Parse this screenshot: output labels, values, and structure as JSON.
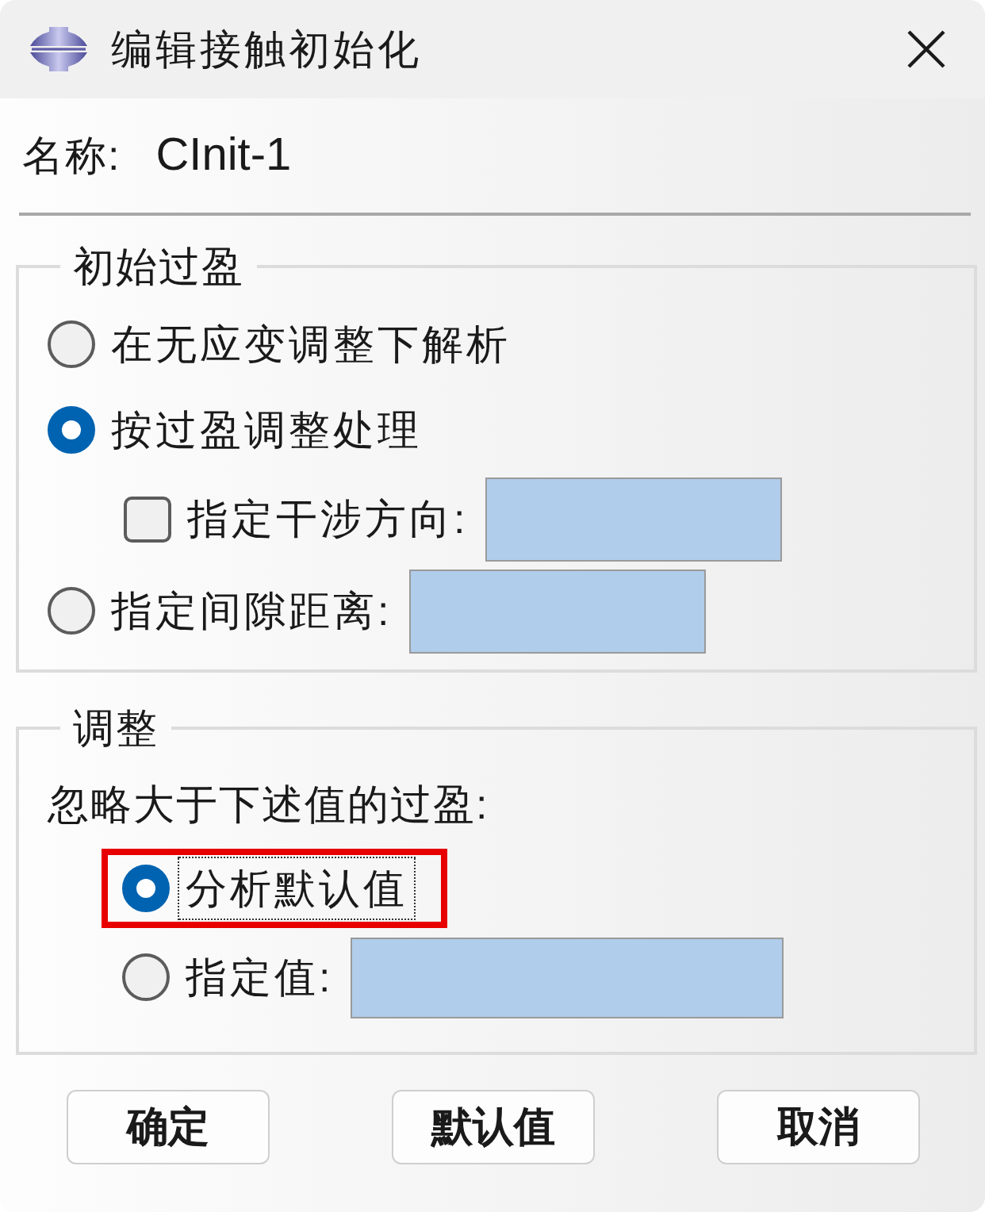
{
  "window": {
    "title": "编辑接触初始化"
  },
  "name": {
    "label": "名称:",
    "value": "CInit-1"
  },
  "groups": [
    {
      "title": "初始过盈",
      "items": [
        {
          "kind": "radio",
          "label": "在无应变调整下解析",
          "selected": false,
          "field": false
        },
        {
          "kind": "radio",
          "label": "按过盈调整处理",
          "selected": true,
          "field": false,
          "children": [
            {
              "kind": "checkbox",
              "label": "指定干涉方向:",
              "checked": false,
              "field": true
            }
          ]
        },
        {
          "kind": "radio",
          "label": "指定间隙距离:",
          "selected": false,
          "field": true
        }
      ]
    },
    {
      "title": "调整",
      "prompt": "忽略大于下述值的过盈:",
      "items": [
        {
          "kind": "radio",
          "label": "分析默认值",
          "selected": true,
          "focused": true,
          "highlighted": true,
          "field": false
        },
        {
          "kind": "radio",
          "label": "指定值:",
          "selected": false,
          "focused": false,
          "highlighted": false,
          "field": true
        }
      ]
    }
  ],
  "buttons": [
    "确定",
    "默认值",
    "取消"
  ]
}
